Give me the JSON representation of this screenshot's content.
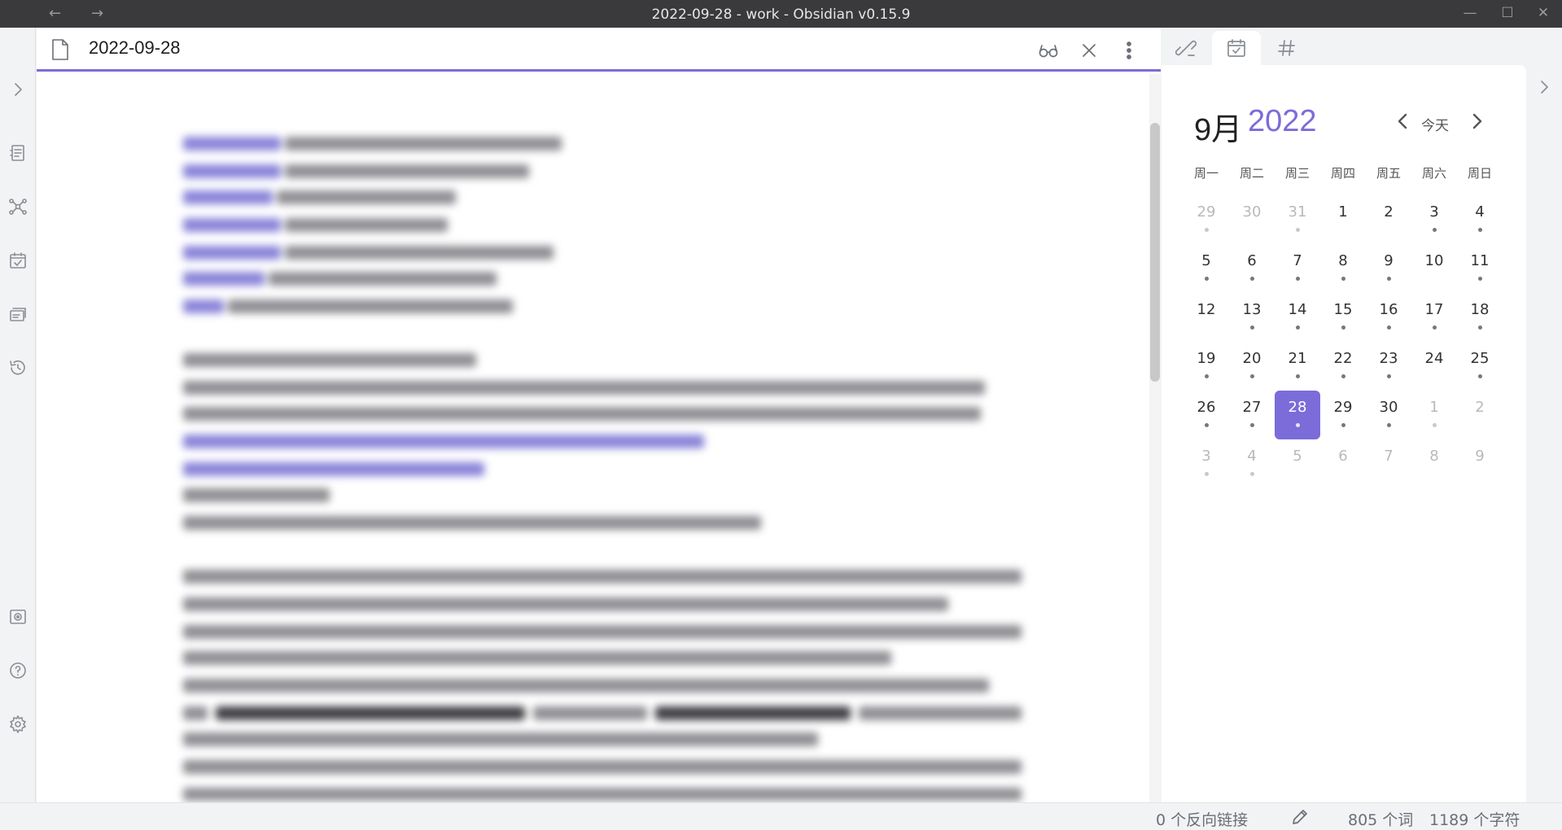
{
  "window": {
    "title": "2022-09-28 - work - Obsidian v0.15.9",
    "back_arrow": "←",
    "forward_arrow": "→",
    "minimize": "—",
    "maximize": "☐",
    "close": "✕"
  },
  "ribbon": {
    "icons": [
      "collapse-sidebar-icon",
      "outline-icon",
      "graph-view-icon",
      "daily-note-icon",
      "slides-icon",
      "history-icon",
      "vault-icon",
      "help-icon",
      "settings-icon"
    ]
  },
  "editor": {
    "file_title": "2022-09-28",
    "actions": [
      "reading-view-icon",
      "close-icon",
      "more-options-icon"
    ]
  },
  "right_panel": {
    "tabs": [
      "backlinks-icon",
      "calendar-icon",
      "tags-icon"
    ],
    "active_tab": "calendar-icon",
    "calendar": {
      "month": "9月",
      "year": "2022",
      "today_label": "今天",
      "weekdays": [
        "周一",
        "周二",
        "周三",
        "周四",
        "周五",
        "周六",
        "周日"
      ],
      "weeks": [
        [
          {
            "d": "29",
            "m": true,
            "dot": true
          },
          {
            "d": "30",
            "m": true,
            "dot": false
          },
          {
            "d": "31",
            "m": true,
            "dot": true
          },
          {
            "d": "1",
            "dot": false
          },
          {
            "d": "2",
            "dot": false
          },
          {
            "d": "3",
            "dot": true
          },
          {
            "d": "4",
            "dot": true
          }
        ],
        [
          {
            "d": "5",
            "dot": true
          },
          {
            "d": "6",
            "dot": true
          },
          {
            "d": "7",
            "dot": true
          },
          {
            "d": "8",
            "dot": true
          },
          {
            "d": "9",
            "dot": true
          },
          {
            "d": "10",
            "dot": false
          },
          {
            "d": "11",
            "dot": true
          }
        ],
        [
          {
            "d": "12",
            "dot": false
          },
          {
            "d": "13",
            "dot": true
          },
          {
            "d": "14",
            "dot": true
          },
          {
            "d": "15",
            "dot": true
          },
          {
            "d": "16",
            "dot": true
          },
          {
            "d": "17",
            "dot": true
          },
          {
            "d": "18",
            "dot": true
          }
        ],
        [
          {
            "d": "19",
            "dot": true
          },
          {
            "d": "20",
            "dot": true
          },
          {
            "d": "21",
            "dot": true
          },
          {
            "d": "22",
            "dot": true
          },
          {
            "d": "23",
            "dot": true
          },
          {
            "d": "24",
            "dot": false
          },
          {
            "d": "25",
            "dot": true
          }
        ],
        [
          {
            "d": "26",
            "dot": true
          },
          {
            "d": "27",
            "dot": true
          },
          {
            "d": "28",
            "dot": true,
            "active": true
          },
          {
            "d": "29",
            "dot": true
          },
          {
            "d": "30",
            "dot": true
          },
          {
            "d": "1",
            "m": true,
            "dot": true
          },
          {
            "d": "2",
            "m": true,
            "dot": false
          }
        ],
        [
          {
            "d": "3",
            "m": true,
            "dot": true
          },
          {
            "d": "4",
            "m": true,
            "dot": true
          },
          {
            "d": "5",
            "m": true,
            "dot": false
          },
          {
            "d": "6",
            "m": true,
            "dot": false
          },
          {
            "d": "7",
            "m": true,
            "dot": false
          },
          {
            "d": "8",
            "m": true,
            "dot": false
          },
          {
            "d": "9",
            "m": true,
            "dot": false
          }
        ]
      ]
    }
  },
  "statusbar": {
    "backlinks": "0 个反向链接",
    "words": "805 个词",
    "chars": "1189 个字符"
  },
  "colors": {
    "accent": "#7b6cd9",
    "titlebar": "#3a3a3c",
    "panel_bg": "#f2f3f5"
  }
}
